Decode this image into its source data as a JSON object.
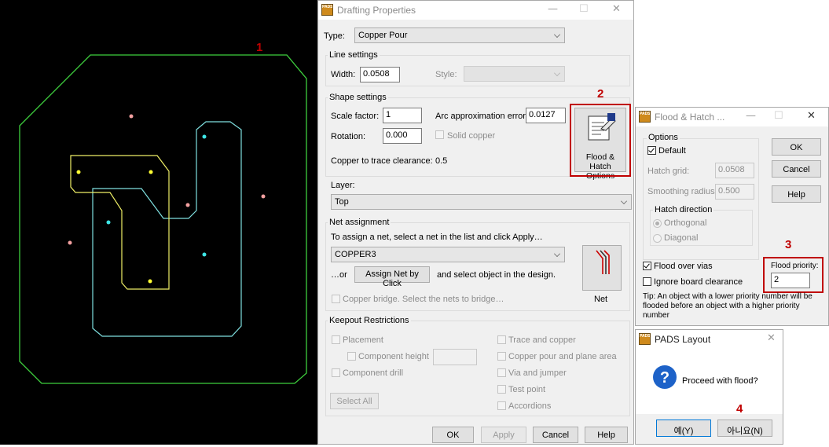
{
  "annotations": {
    "step1": "1",
    "step2": "2",
    "step3": "3",
    "step4": "4"
  },
  "colors": {
    "accent_red": "#c00000",
    "outline_green": "#3ecf3e",
    "outline_yellow": "#eeee66",
    "outline_cyan": "#7fe0e0"
  },
  "drafting": {
    "title": "Drafting Properties",
    "type_label": "Type:",
    "type_value": "Copper Pour",
    "line_settings": "Line settings",
    "width_label": "Width:",
    "width_value": "0.0508",
    "style_label": "Style:",
    "shape_settings": "Shape settings",
    "scale_label": "Scale factor:",
    "scale_value": "1",
    "arc_label": "Arc approximation error:",
    "arc_value": "0.0127",
    "rotation_label": "Rotation:",
    "rotation_value": "0.000",
    "solid_copper": "Solid copper",
    "clearance_label": "Copper to trace clearance:",
    "clearance_value": "0.5",
    "flood_btn_line1": "Flood & Hatch",
    "flood_btn_line2": "Options",
    "layer_label": "Layer:",
    "layer_value": "Top",
    "net_assignment": "Net assignment",
    "net_instruction": "To assign a net, select a net in the list and click Apply…",
    "net_value": "COPPER3",
    "or_label": "…or",
    "assign_btn": "Assign Net by Click",
    "assign_after": "and select object in the design.",
    "net_btn": "Net",
    "copper_bridge": "Copper bridge. Select the nets to bridge…",
    "keepout": "Keepout Restrictions",
    "placement": "Placement",
    "component_height": "Component height",
    "component_drill": "Component drill",
    "trace_copper": "Trace and copper",
    "pour_plane": "Copper pour and plane area",
    "via_jumper": "Via and jumper",
    "test_point": "Test point",
    "accordions": "Accordions",
    "select_all": "Select All",
    "ok": "OK",
    "apply": "Apply",
    "cancel": "Cancel",
    "help": "Help"
  },
  "flood": {
    "title": "Flood & Hatch ...",
    "options": "Options",
    "default": "Default",
    "hatch_grid_label": "Hatch grid:",
    "hatch_grid_value": "0.0508",
    "smoothing_label": "Smoothing radius:",
    "smoothing_value": "0.500",
    "hatch_direction": "Hatch direction",
    "orthogonal": "Orthogonal",
    "diagonal": "Diagonal",
    "flood_over_vias": "Flood over vias",
    "ignore_clearance": "Ignore board clearance",
    "priority_label": "Flood priority:",
    "priority_value": "2",
    "tip": "Tip:  An object with a lower priority number will be flooded before an object with a higher priority number",
    "ok": "OK",
    "cancel": "Cancel",
    "help": "Help"
  },
  "pads": {
    "title": "PADS Layout",
    "message": "Proceed with flood?",
    "yes": "예(Y)",
    "no": "아니요(N)"
  }
}
